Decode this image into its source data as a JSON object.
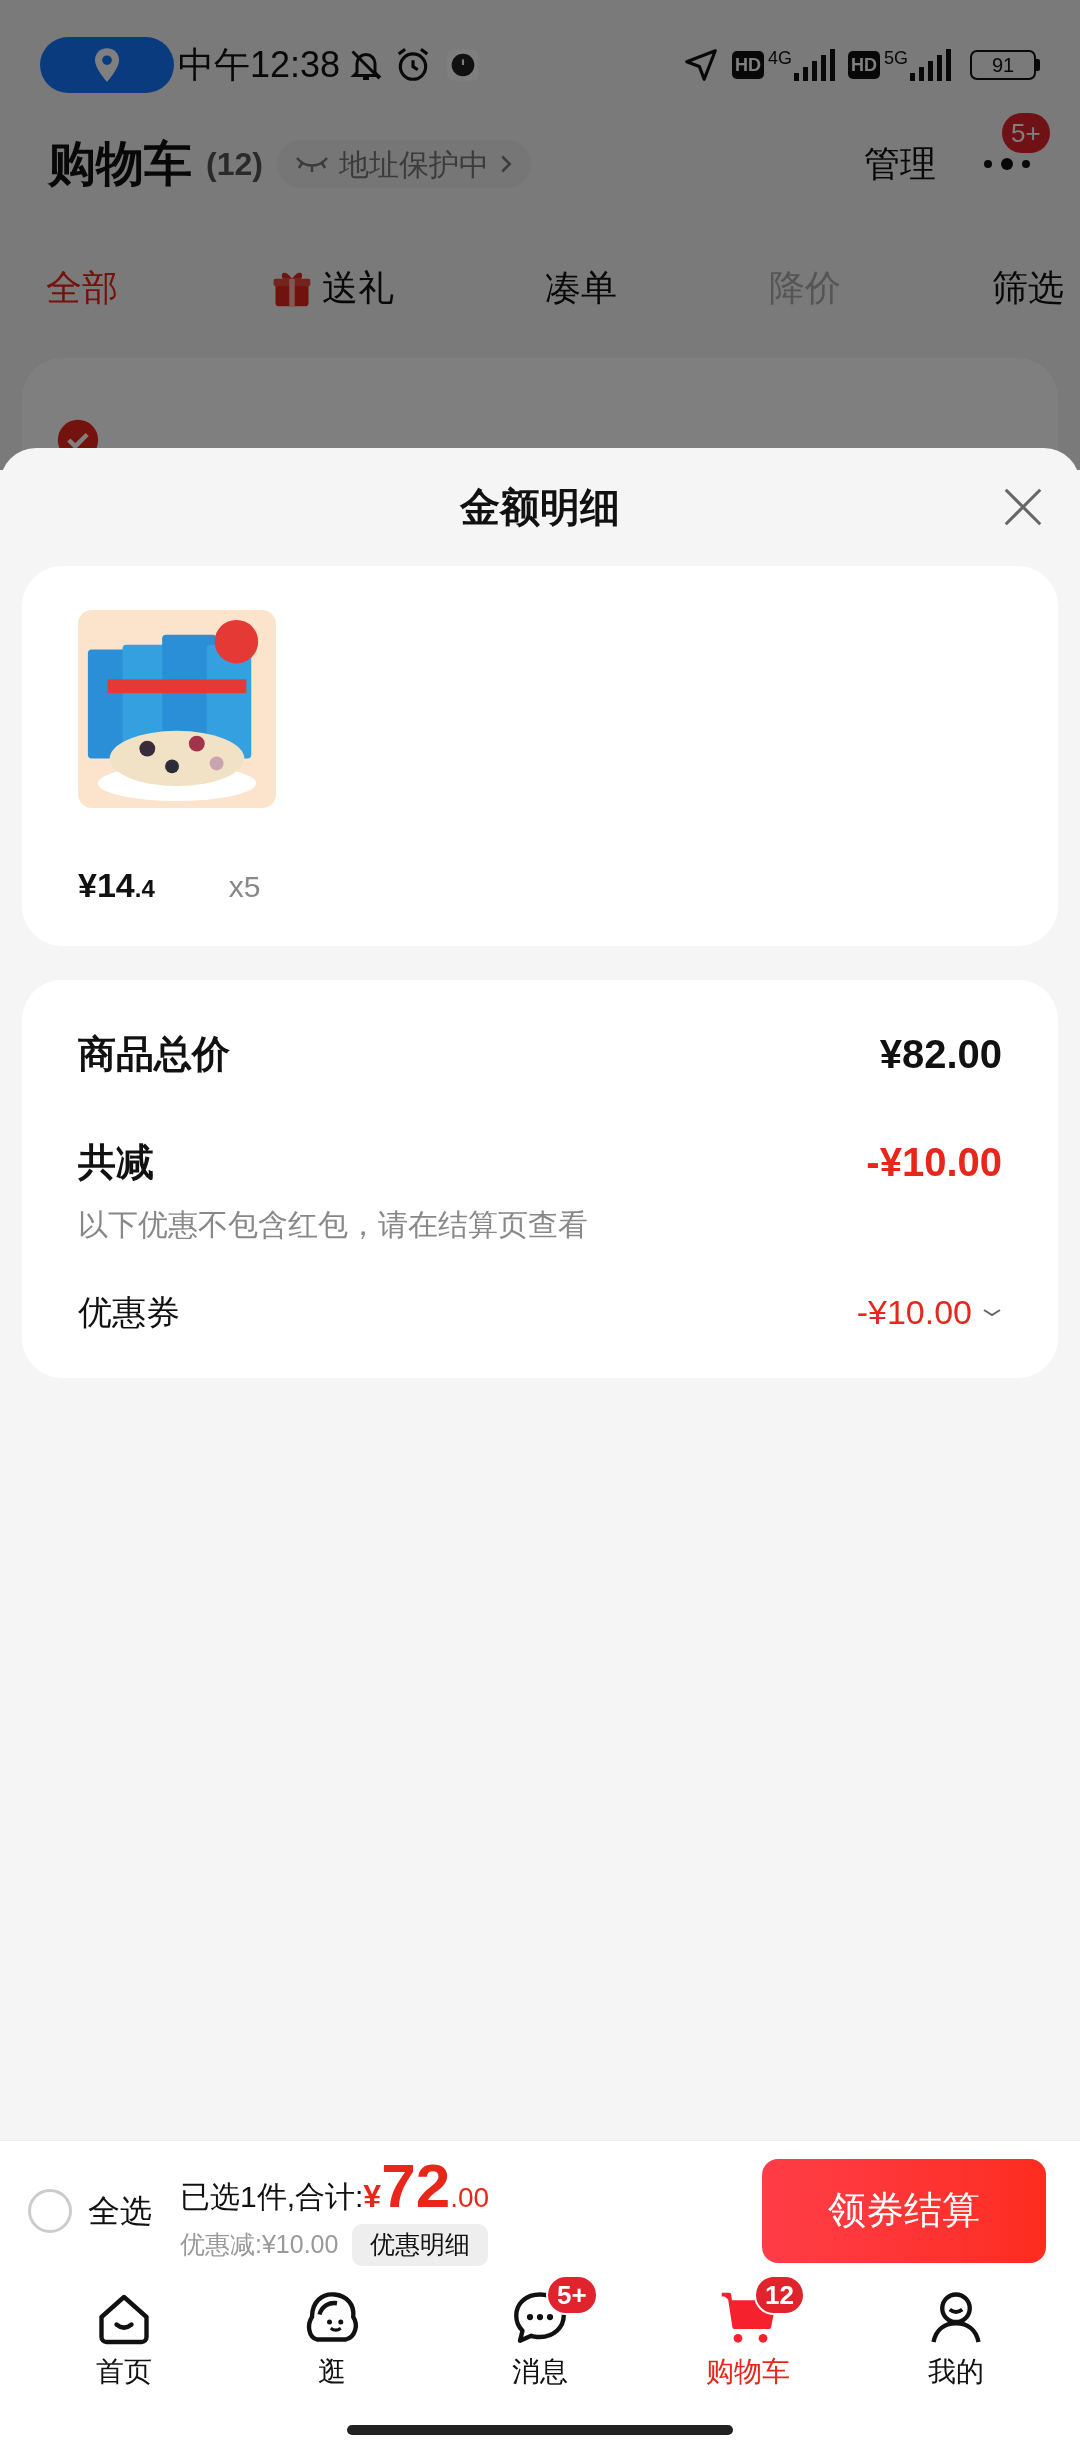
{
  "status_bar": {
    "time": "中午12:38",
    "indicators": [
      "HD",
      "4G",
      "HD",
      "5G"
    ],
    "battery": "91"
  },
  "header": {
    "title": "购物车",
    "count": "(12)",
    "address_badge": "地址保护中",
    "manage": "管理",
    "more_badge": "5+"
  },
  "filter_tabs": [
    {
      "label": "全部",
      "selected": true,
      "disabled": false,
      "kind": "plain"
    },
    {
      "label": "送礼",
      "selected": false,
      "disabled": false,
      "kind": "gift"
    },
    {
      "label": "凑单",
      "selected": false,
      "disabled": false,
      "kind": "plain"
    },
    {
      "label": "降价",
      "selected": false,
      "disabled": true,
      "kind": "plain"
    },
    {
      "label": "筛选",
      "selected": false,
      "disabled": false,
      "kind": "plain"
    }
  ],
  "sheet": {
    "title": "金额明细",
    "items": [
      {
        "kind": "picture",
        "price_main": "¥14",
        "price_decimal": ".4",
        "quantity": "x5"
      }
    ],
    "total_label": "商品总价",
    "total_value": "¥82.00",
    "discount_label": "共减",
    "discount_value": "-¥10.00",
    "discount_note": "以下优惠不包含红包，请在结算页查看",
    "coupon_label": "优惠券",
    "coupon_value": "-¥10.00"
  },
  "checkout": {
    "select_all": {
      "label": "全选",
      "checked": false
    },
    "summary": "已选1件,合计:",
    "currency": "¥",
    "amount_int": "72",
    "amount_dec": ".00",
    "saved": "优惠减:¥10.00",
    "detail_button": "优惠明细",
    "checkout_button": "领券结算"
  },
  "nav": [
    {
      "kind": "home",
      "label": "首页",
      "selected": false
    },
    {
      "kind": "browse",
      "label": "逛",
      "selected": false
    },
    {
      "kind": "message",
      "label": "消息",
      "selected": false,
      "badge": "5+"
    },
    {
      "kind": "cart",
      "label": "购物车",
      "selected": true,
      "badge": "12"
    },
    {
      "kind": "profile",
      "label": "我的",
      "selected": false
    }
  ]
}
